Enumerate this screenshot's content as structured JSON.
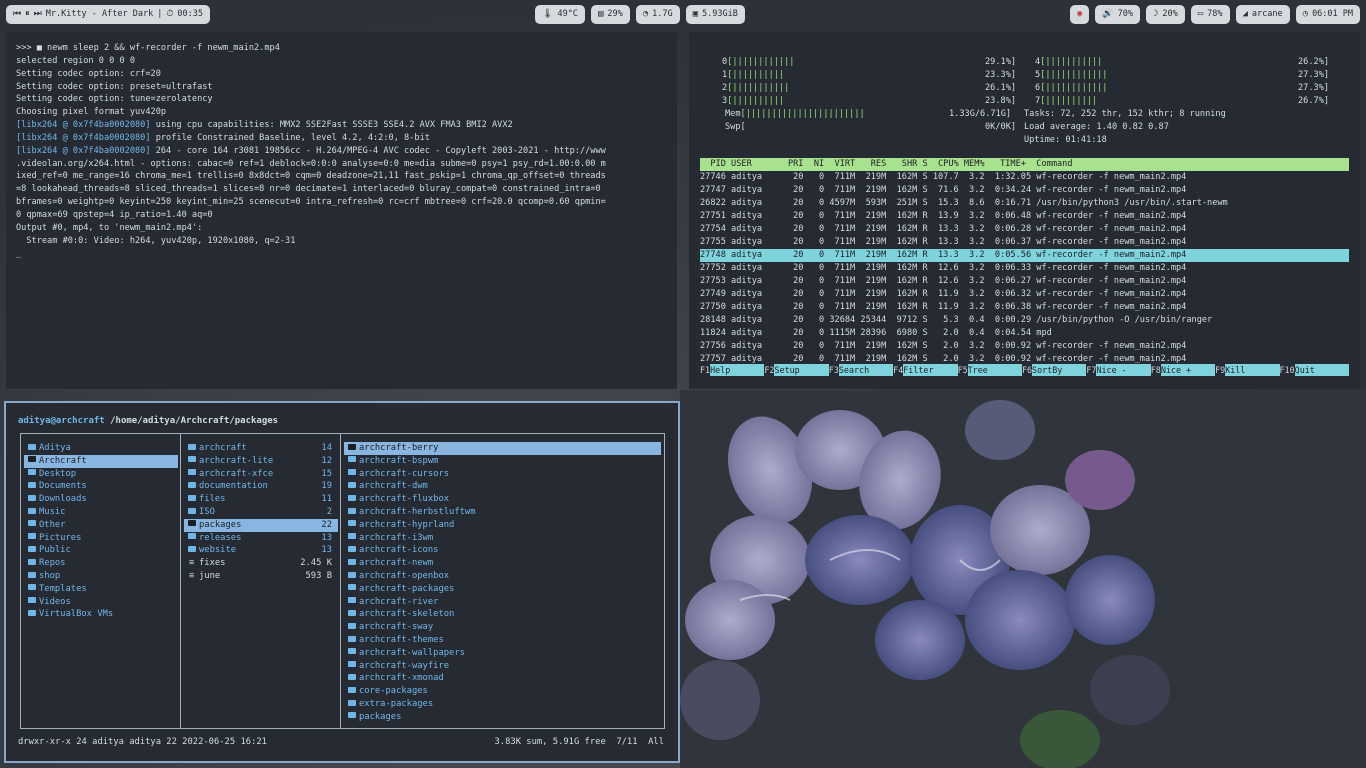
{
  "topbar": {
    "media": {
      "prev": "⏮",
      "pause": "⏸",
      "next": "⏭",
      "title": "Mr.Kitty - After Dark",
      "timer_icon": "⏱",
      "time": "00:35"
    },
    "stats": [
      {
        "icon": "🌡",
        "label": "49°C"
      },
      {
        "icon": "▤",
        "label": "29%"
      },
      {
        "icon": "◔",
        "label": "1.7G"
      },
      {
        "icon": "▣",
        "label": "5.93GiB"
      }
    ],
    "right": [
      {
        "icon": "◉",
        "label": ""
      },
      {
        "icon": "🔊",
        "label": "70%"
      },
      {
        "icon": "☽",
        "label": "20%"
      },
      {
        "icon": "▭",
        "label": "78%"
      },
      {
        "icon": "◢",
        "label": "arcane"
      },
      {
        "icon": "◷",
        "label": "06:01 PM"
      }
    ]
  },
  "terminal": {
    "lines": [
      ">>> ■ newm sleep 2 && wf-recorder -f newm_main2.mp4",
      "selected region 0 0 0 0",
      "Setting codec option: crf=20",
      "Setting codec option: preset=ultrafast",
      "Setting codec option: tune=zerolatency",
      "Choosing pixel format yuv420p",
      "[libx264 @ 0x7f4ba0002080] using cpu capabilities: MMX2 SSE2Fast SSSE3 SSE4.2 AVX FMA3 BMI2 AVX2",
      "[libx264 @ 0x7f4ba0002080] profile Constrained Baseline, level 4.2, 4:2:0, 8-bit",
      "[libx264 @ 0x7f4ba0002080] 264 - core 164 r3081 19856cc - H.264/MPEG-4 AVC codec - Copyleft 2003-2021 - http://www",
      ".videolan.org/x264.html - options: cabac=0 ref=1 deblock=0:0:0 analyse=0:0 me=dia subme=0 psy=1 psy_rd=1.00:0.00 m",
      "ixed_ref=0 me_range=16 chroma_me=1 trellis=0 8x8dct=0 cqm=0 deadzone=21,11 fast_pskip=1 chroma_qp_offset=0 threads",
      "=8 lookahead_threads=8 sliced_threads=1 slices=8 nr=0 decimate=1 interlaced=0 bluray_compat=0 constrained_intra=0",
      "bframes=0 weightp=0 keyint=250 keyint_min=25 scenecut=0 intra_refresh=0 rc=crf mbtree=0 crf=20.0 qcomp=0.60 qpmin=",
      "0 qpmax=69 qpstep=4 ip_ratio=1.40 aq=0",
      "Output #0, mp4, to 'newm_main2.mp4':",
      "  Stream #0:0: Video: h264, yuv420p, 1920x1080, q=2-31",
      "",
      "_"
    ]
  },
  "htop": {
    "cpus": [
      {
        "id": "0",
        "bar": "[||||||||||||",
        "pct": "29.1%]"
      },
      {
        "id": "1",
        "bar": "[||||||||||",
        "pct": "23.3%]"
      },
      {
        "id": "2",
        "bar": "[|||||||||||",
        "pct": "26.1%]"
      },
      {
        "id": "3",
        "bar": "[||||||||||",
        "pct": "23.8%]"
      },
      {
        "id": "4",
        "bar": "[|||||||||||",
        "pct": "26.2%]"
      },
      {
        "id": "5",
        "bar": "[||||||||||||",
        "pct": "27.3%]"
      },
      {
        "id": "6",
        "bar": "[||||||||||||",
        "pct": "27.3%]"
      },
      {
        "id": "7",
        "bar": "[||||||||||",
        "pct": "26.7%]"
      }
    ],
    "mem": {
      "label": "Mem",
      "bar": "[|||||||||||||||||||||||",
      "value": "1.33G/6.71G]"
    },
    "swp": {
      "label": "Swp",
      "bar": "[",
      "value": "0K/0K]"
    },
    "tasks": "Tasks: 72, 252 thr, 152 kthr; 8 running",
    "load": "Load average: 1.40 0.82 0.87",
    "uptime": "Uptime: 01:41:18",
    "header": "  PID USER       PRI  NI  VIRT   RES   SHR S  CPU% MEM%   TIME+  Command",
    "procs": [
      "27746 aditya      20   0  711M  219M  162M S 107.7  3.2  1:32.05 wf-recorder -f newm_main2.mp4",
      "27747 aditya      20   0  711M  219M  162M S  71.6  3.2  0:34.24 wf-recorder -f newm_main2.mp4",
      "26822 aditya      20   0 4597M  593M  251M S  15.3  8.6  0:16.71 /usr/bin/python3 /usr/bin/.start-newm",
      "27751 aditya      20   0  711M  219M  162M R  13.9  3.2  0:06.48 wf-recorder -f newm_main2.mp4",
      "27754 aditya      20   0  711M  219M  162M R  13.3  3.2  0:06.28 wf-recorder -f newm_main2.mp4",
      "27755 aditya      20   0  711M  219M  162M R  13.3  3.2  0:06.37 wf-recorder -f newm_main2.mp4",
      "27748 aditya      20   0  711M  219M  162M R  13.3  3.2  0:05.56 wf-recorder -f newm_main2.mp4",
      "27752 aditya      20   0  711M  219M  162M R  12.6  3.2  0:06.33 wf-recorder -f newm_main2.mp4",
      "27753 aditya      20   0  711M  219M  162M R  12.6  3.2  0:06.27 wf-recorder -f newm_main2.mp4",
      "27749 aditya      20   0  711M  219M  162M R  11.9  3.2  0:06.32 wf-recorder -f newm_main2.mp4",
      "27750 aditya      20   0  711M  219M  162M R  11.9  3.2  0:06.38 wf-recorder -f newm_main2.mp4",
      "28148 aditya      20   0 32684 25344  9712 S   5.3  0.4  0:00.29 /usr/bin/python -O /usr/bin/ranger",
      "11824 aditya      20   0 1115M 28396  6980 S   2.0  0.4  0:04.54 mpd",
      "27756 aditya      20   0  711M  219M  162M S   2.0  3.2  0:00.92 wf-recorder -f newm_main2.mp4",
      "27757 aditya      20   0  711M  219M  162M S   2.0  3.2  0:00.92 wf-recorder -f newm_main2.mp4"
    ],
    "selected_index": 6,
    "fkeys": [
      {
        "k": "F1",
        "v": "Help  "
      },
      {
        "k": "F2",
        "v": "Setup "
      },
      {
        "k": "F3",
        "v": "Search"
      },
      {
        "k": "F4",
        "v": "Filter"
      },
      {
        "k": "F5",
        "v": "Tree  "
      },
      {
        "k": "F6",
        "v": "SortBy"
      },
      {
        "k": "F7",
        "v": "Nice -"
      },
      {
        "k": "F8",
        "v": "Nice +"
      },
      {
        "k": "F9",
        "v": "Kill  "
      },
      {
        "k": "F10",
        "v": "Quit  "
      }
    ]
  },
  "ranger": {
    "user": "aditya@archcraft",
    "path": "/home/aditya/Archcraft/packages",
    "col1": [
      "Aditya",
      "Archcraft",
      "Desktop",
      "Documents",
      "Downloads",
      "Music",
      "Other",
      "Pictures",
      "Public",
      "Repos",
      "shop",
      "Templates",
      "Videos",
      "VirtualBox VMs"
    ],
    "col1_sel": 1,
    "col2": [
      {
        "name": "archcraft",
        "size": "14",
        "dir": true
      },
      {
        "name": "archcraft-lite",
        "size": "12",
        "dir": true
      },
      {
        "name": "archcraft-xfce",
        "size": "15",
        "dir": true
      },
      {
        "name": "documentation",
        "size": "19",
        "dir": true
      },
      {
        "name": "files",
        "size": "11",
        "dir": true
      },
      {
        "name": "ISO",
        "size": "2",
        "dir": true
      },
      {
        "name": "packages",
        "size": "22",
        "dir": true
      },
      {
        "name": "releases",
        "size": "13",
        "dir": true
      },
      {
        "name": "website",
        "size": "13",
        "dir": true
      },
      {
        "name": "fixes",
        "size": "2.45 K",
        "dir": false
      },
      {
        "name": "june",
        "size": "593 B",
        "dir": false
      }
    ],
    "col2_sel": 6,
    "col3": [
      "archcraft-berry",
      "archcraft-bspwm",
      "archcraft-cursors",
      "archcraft-dwm",
      "archcraft-fluxbox",
      "archcraft-herbstluftwm",
      "archcraft-hyprland",
      "archcraft-i3wm",
      "archcraft-icons",
      "archcraft-newm",
      "archcraft-openbox",
      "archcraft-packages",
      "archcraft-river",
      "archcraft-skeleton",
      "archcraft-sway",
      "archcraft-themes",
      "archcraft-wallpapers",
      "archcraft-wayfire",
      "archcraft-xmonad",
      "core-packages",
      "extra-packages",
      "packages"
    ],
    "col3_sel": 0,
    "status_left": "drwxr-xr-x 24 aditya aditya 22 2022-06-25 16:21",
    "status_right": "3.83K sum, 5.91G free  7/11  All"
  }
}
